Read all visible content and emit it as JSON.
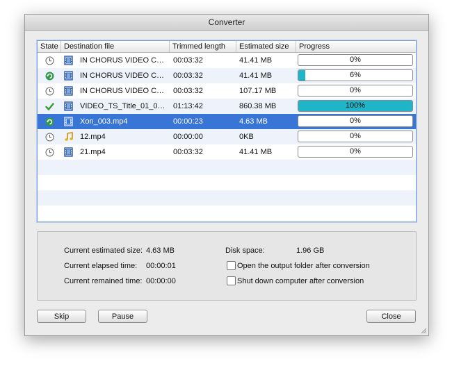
{
  "window": {
    "title": "Converter"
  },
  "table": {
    "headers": {
      "state": "State",
      "destination": "Destination file",
      "trimmed": "Trimmed length",
      "size": "Estimated size",
      "progress": "Progress"
    },
    "rows": [
      {
        "state": "waiting",
        "type": "video",
        "name": "IN CHORUS VIDEO CLI...",
        "trimmed": "00:03:32",
        "size": "41.41 MB",
        "progress": 0,
        "progress_label": "0%"
      },
      {
        "state": "converting",
        "type": "video",
        "name": "IN CHORUS VIDEO CLI...",
        "trimmed": "00:03:32",
        "size": "41.41 MB",
        "progress": 6,
        "progress_label": "6%"
      },
      {
        "state": "waiting",
        "type": "video",
        "name": "IN CHORUS VIDEO CLI...",
        "trimmed": "00:03:32",
        "size": "107.17 MB",
        "progress": 0,
        "progress_label": "0%"
      },
      {
        "state": "done",
        "type": "video",
        "name": "VIDEO_TS_Title_01_01...",
        "trimmed": "01:13:42",
        "size": "860.38 MB",
        "progress": 100,
        "progress_label": "100%"
      },
      {
        "state": "converting",
        "type": "video",
        "name": "Xon_003.mp4",
        "trimmed": "00:00:23",
        "size": "4.63 MB",
        "progress": 0,
        "progress_label": "0%",
        "selected": true
      },
      {
        "state": "waiting",
        "type": "audio",
        "name": "12.mp4",
        "trimmed": "00:00:00",
        "size": "0KB",
        "progress": 0,
        "progress_label": "0%"
      },
      {
        "state": "waiting",
        "type": "video",
        "name": "21.mp4",
        "trimmed": "00:03:32",
        "size": "41.41 MB",
        "progress": 0,
        "progress_label": "0%"
      }
    ]
  },
  "info": {
    "est_size_label": "Current estimated size:",
    "est_size_value": "4.63 MB",
    "elapsed_label": "Current elapsed time:",
    "elapsed_value": "00:00:01",
    "remained_label": "Current remained time:",
    "remained_value": "00:00:00",
    "disk_label": "Disk space:",
    "disk_value": "1.96 GB",
    "open_folder_label": "Open the output folder after conversion",
    "open_folder_checked": false,
    "shutdown_label": "Shut down computer after conversion",
    "shutdown_checked": false
  },
  "buttons": {
    "skip": "Skip",
    "pause": "Pause",
    "close": "Close"
  },
  "colors": {
    "progress": "#1fb5c9",
    "selection": "#3875d7",
    "done_check": "#2e9b2e",
    "converting": "#2f9a48"
  }
}
